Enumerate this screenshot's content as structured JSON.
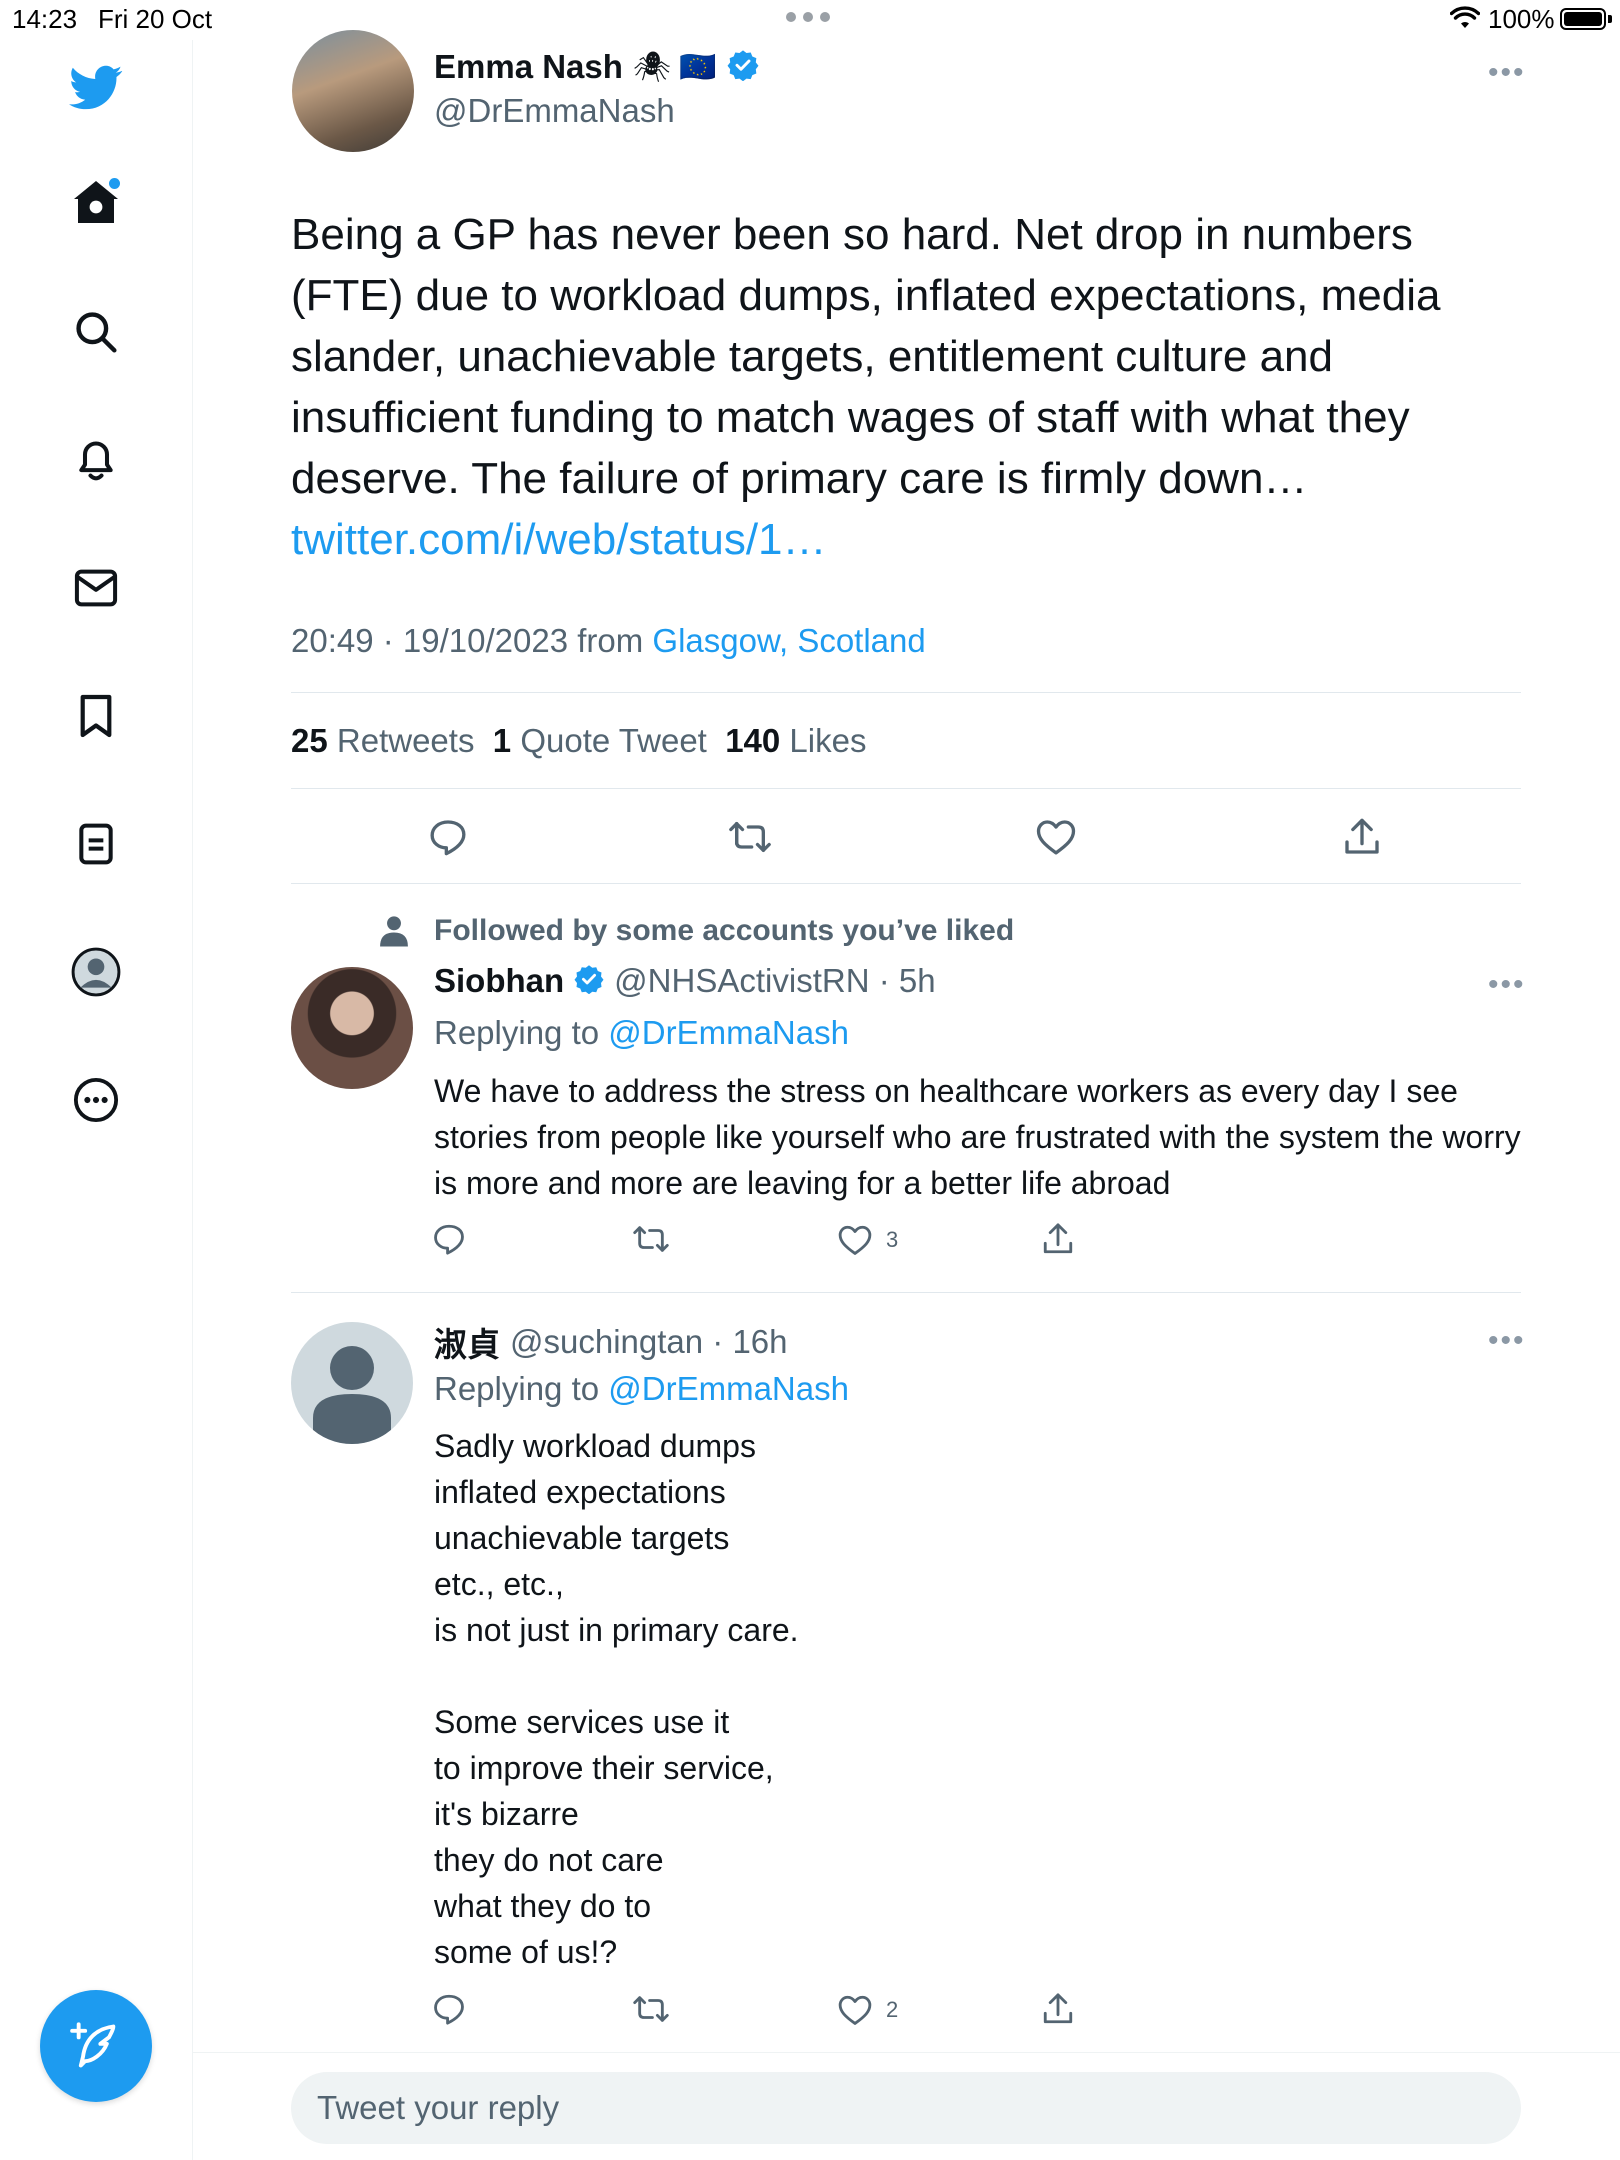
{
  "status_bar": {
    "time": "14:23",
    "date": "Fri 20 Oct",
    "battery": "100%"
  },
  "sidebar": {
    "items": [
      {
        "icon": "twitter-bird-icon"
      },
      {
        "icon": "home-icon"
      },
      {
        "icon": "search-icon"
      },
      {
        "icon": "bell-icon"
      },
      {
        "icon": "mail-icon"
      },
      {
        "icon": "bookmark-icon"
      },
      {
        "icon": "lists-icon"
      },
      {
        "icon": "profile-icon"
      },
      {
        "icon": "more-icon"
      }
    ],
    "compose_icon": "compose-feather-icon"
  },
  "tweet": {
    "author_name": "Emma Nash",
    "author_emojis": "🕷 🇪🇺",
    "handle": "@DrEmmaNash",
    "text": "Being a GP has never been so hard. Net drop in numbers (FTE) due to workload dumps, inflated expectations, media slander, unachievable targets, entitlement culture and insufficient funding to match wages of staff with what they deserve. The failure of primary care is firmly down…",
    "link": "twitter.com/i/web/status/1…",
    "timestamp": "20:49 · 19/10/2023 from ",
    "location": "Glasgow, Scotland",
    "retweets_count": "25",
    "retweets_label": "Retweets",
    "quotes_count": "1",
    "quotes_label": "Quote Tweet",
    "likes_count": "140",
    "likes_label": "Likes"
  },
  "replies": [
    {
      "context": "Followed by some accounts you’ve liked",
      "name": "Siobhan",
      "handle": "@NHSActivistRN · 5h",
      "replying_label": "Replying to ",
      "replying_to": "@DrEmmaNash",
      "text": "We have to address the stress on healthcare workers as every day I see stories from people like yourself who are frustrated with the system the worry is more and more are leaving for a better life abroad",
      "like_count": "3"
    },
    {
      "name": "淑貞",
      "handle": "@suchingtan · 16h",
      "replying_label": "Replying to ",
      "replying_to": "@DrEmmaNash",
      "text": "Sadly workload dumps\ninflated expectations\nunachievable targets\netc., etc.,\nis not just in primary care.\n\nSome services use it\nto improve their service,\nit's bizarre\nthey do not care\nwhat they do to\nsome of us!?",
      "like_count": "2"
    }
  ],
  "reply_box": {
    "placeholder": "Tweet your reply"
  },
  "colors": {
    "accent": "#1d9bf0",
    "text": "#0f1419",
    "secondary": "#536471"
  }
}
